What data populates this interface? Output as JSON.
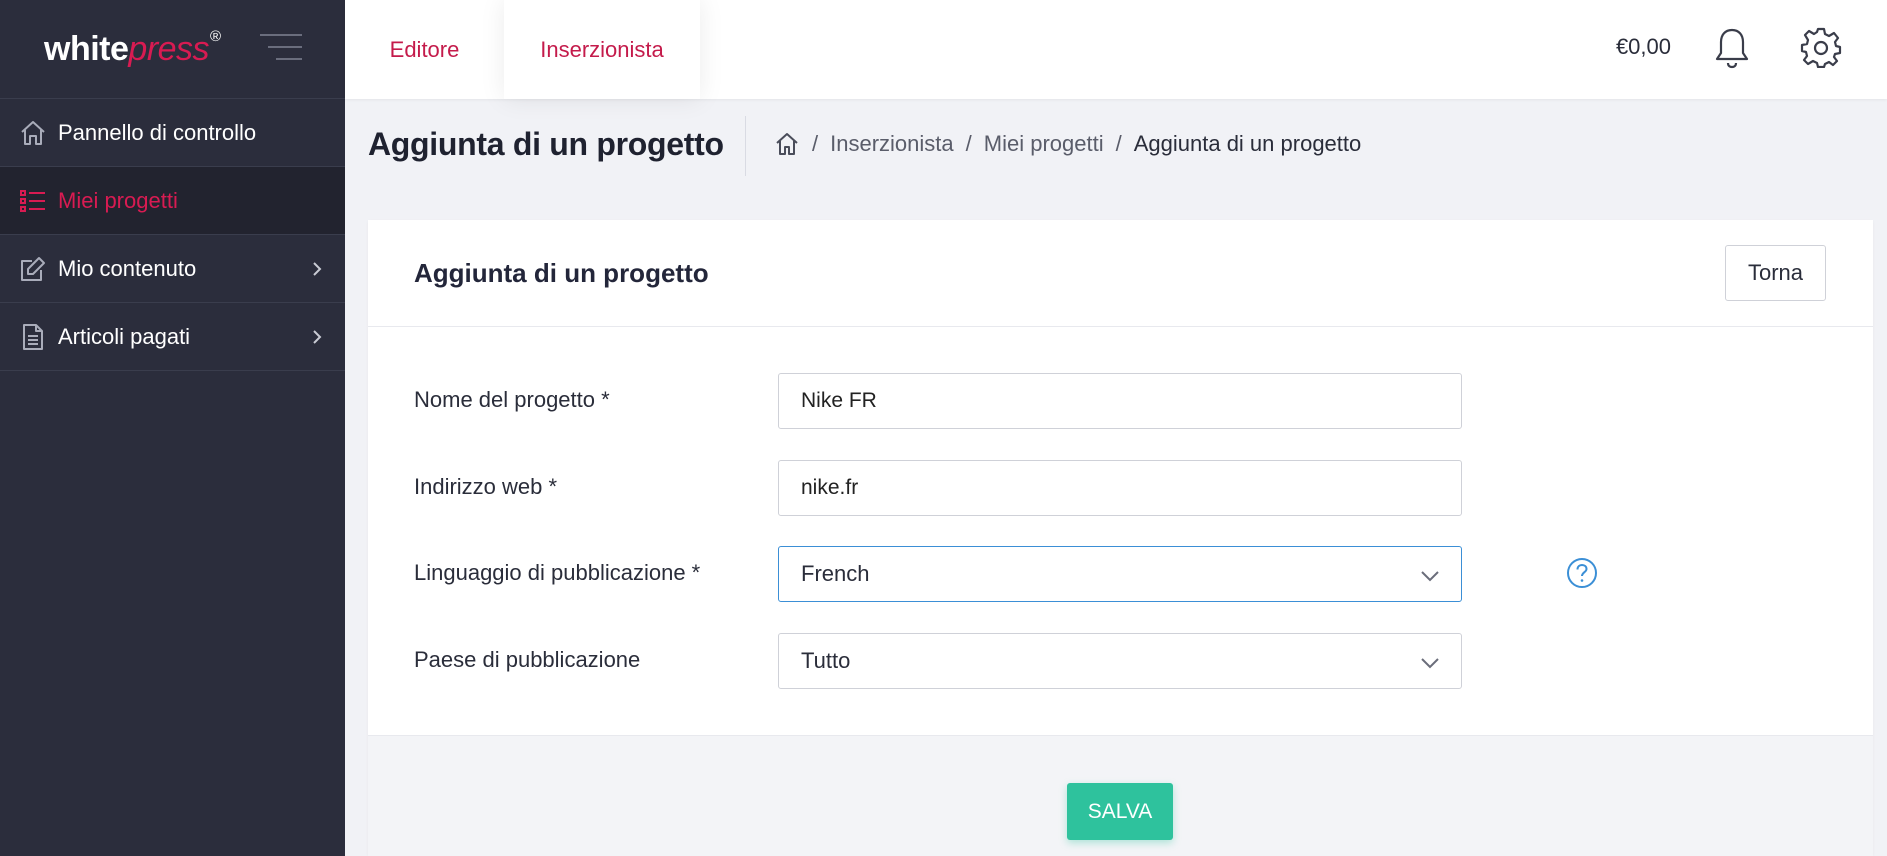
{
  "brand": {
    "logo_part1": "white",
    "logo_part2": "press",
    "logo_mark": "®"
  },
  "sidebar": {
    "items": [
      {
        "label": "Pannello di controllo",
        "icon": "home-icon"
      },
      {
        "label": "Miei progetti",
        "icon": "list-icon",
        "active": true
      },
      {
        "label": "Mio contenuto",
        "icon": "edit-icon",
        "has_submenu": true
      },
      {
        "label": "Articoli pagati",
        "icon": "document-icon",
        "has_submenu": true
      }
    ]
  },
  "topbar": {
    "tabs": [
      {
        "label": "Editore"
      },
      {
        "label": "Inserzionista",
        "active": true
      }
    ],
    "balance": "€0,00"
  },
  "page": {
    "title": "Aggiunta di un progetto",
    "breadcrumb": [
      "Inserzionista",
      "Miei progetti",
      "Aggiunta di un progetto"
    ],
    "breadcrumb_sep": "/"
  },
  "card": {
    "title": "Aggiunta di un progetto",
    "back_label": "Torna",
    "fields": {
      "name": {
        "label": "Nome del progetto *",
        "value": "Nike FR"
      },
      "url": {
        "label": "Indirizzo web *",
        "value": "nike.fr"
      },
      "language": {
        "label": "Linguaggio di pubblicazione *",
        "value": "French"
      },
      "country": {
        "label": "Paese di pubblicazione",
        "value": "Tutto"
      }
    },
    "save_label": "SALVA"
  },
  "colors": {
    "accent": "#d81b52",
    "sidebar_bg": "#2b2d3c",
    "save_green": "#2ec29d",
    "focus_blue": "#3b8fd6"
  }
}
